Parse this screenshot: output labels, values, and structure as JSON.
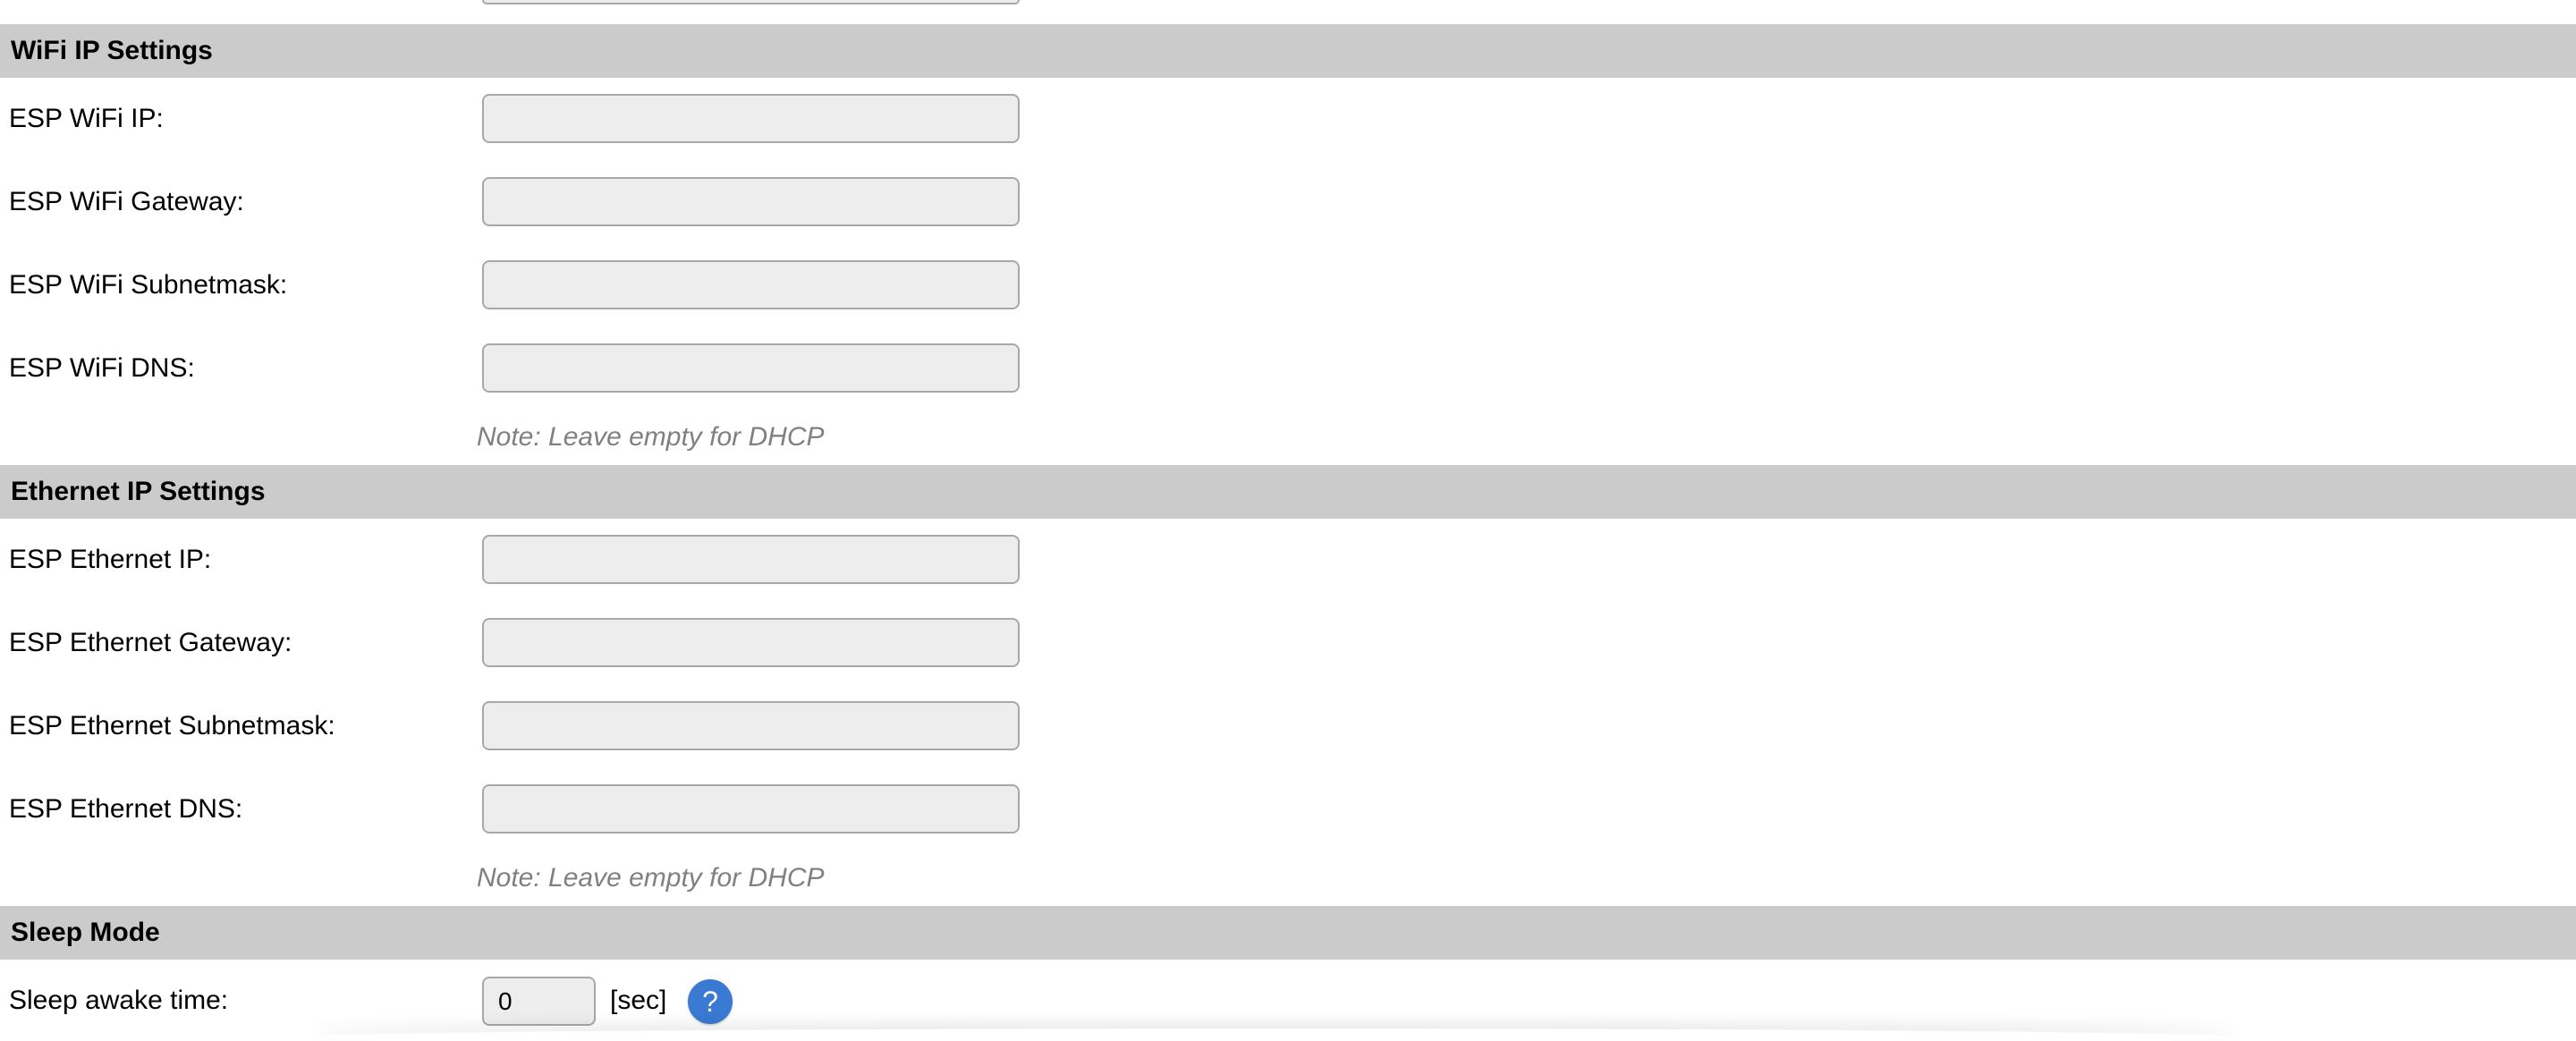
{
  "sections": [
    {
      "title": "WiFi IP Settings",
      "fields": [
        {
          "label": "ESP WiFi IP:",
          "value": ""
        },
        {
          "label": "ESP WiFi Gateway:",
          "value": ""
        },
        {
          "label": "ESP WiFi Subnetmask:",
          "value": ""
        },
        {
          "label": "ESP WiFi DNS:",
          "value": ""
        }
      ],
      "note": "Note: Leave empty for DHCP"
    },
    {
      "title": "Ethernet IP Settings",
      "fields": [
        {
          "label": "ESP Ethernet IP:",
          "value": ""
        },
        {
          "label": "ESP Ethernet Gateway:",
          "value": ""
        },
        {
          "label": "ESP Ethernet Subnetmask:",
          "value": ""
        },
        {
          "label": "ESP Ethernet DNS:",
          "value": ""
        }
      ],
      "note": "Note: Leave empty for DHCP"
    },
    {
      "title": "Sleep Mode",
      "sleep": {
        "label": "Sleep awake time:",
        "value": "0",
        "unit": "[sec]",
        "help_symbol": "?"
      }
    }
  ],
  "colors": {
    "section_header_bg": "#cbcbcb",
    "field_bg": "#ededed",
    "field_border": "#a8a8a8",
    "note_text": "#808080",
    "help_button": "#3a7ad3"
  },
  "icons": {
    "help": "question-mark-icon"
  }
}
